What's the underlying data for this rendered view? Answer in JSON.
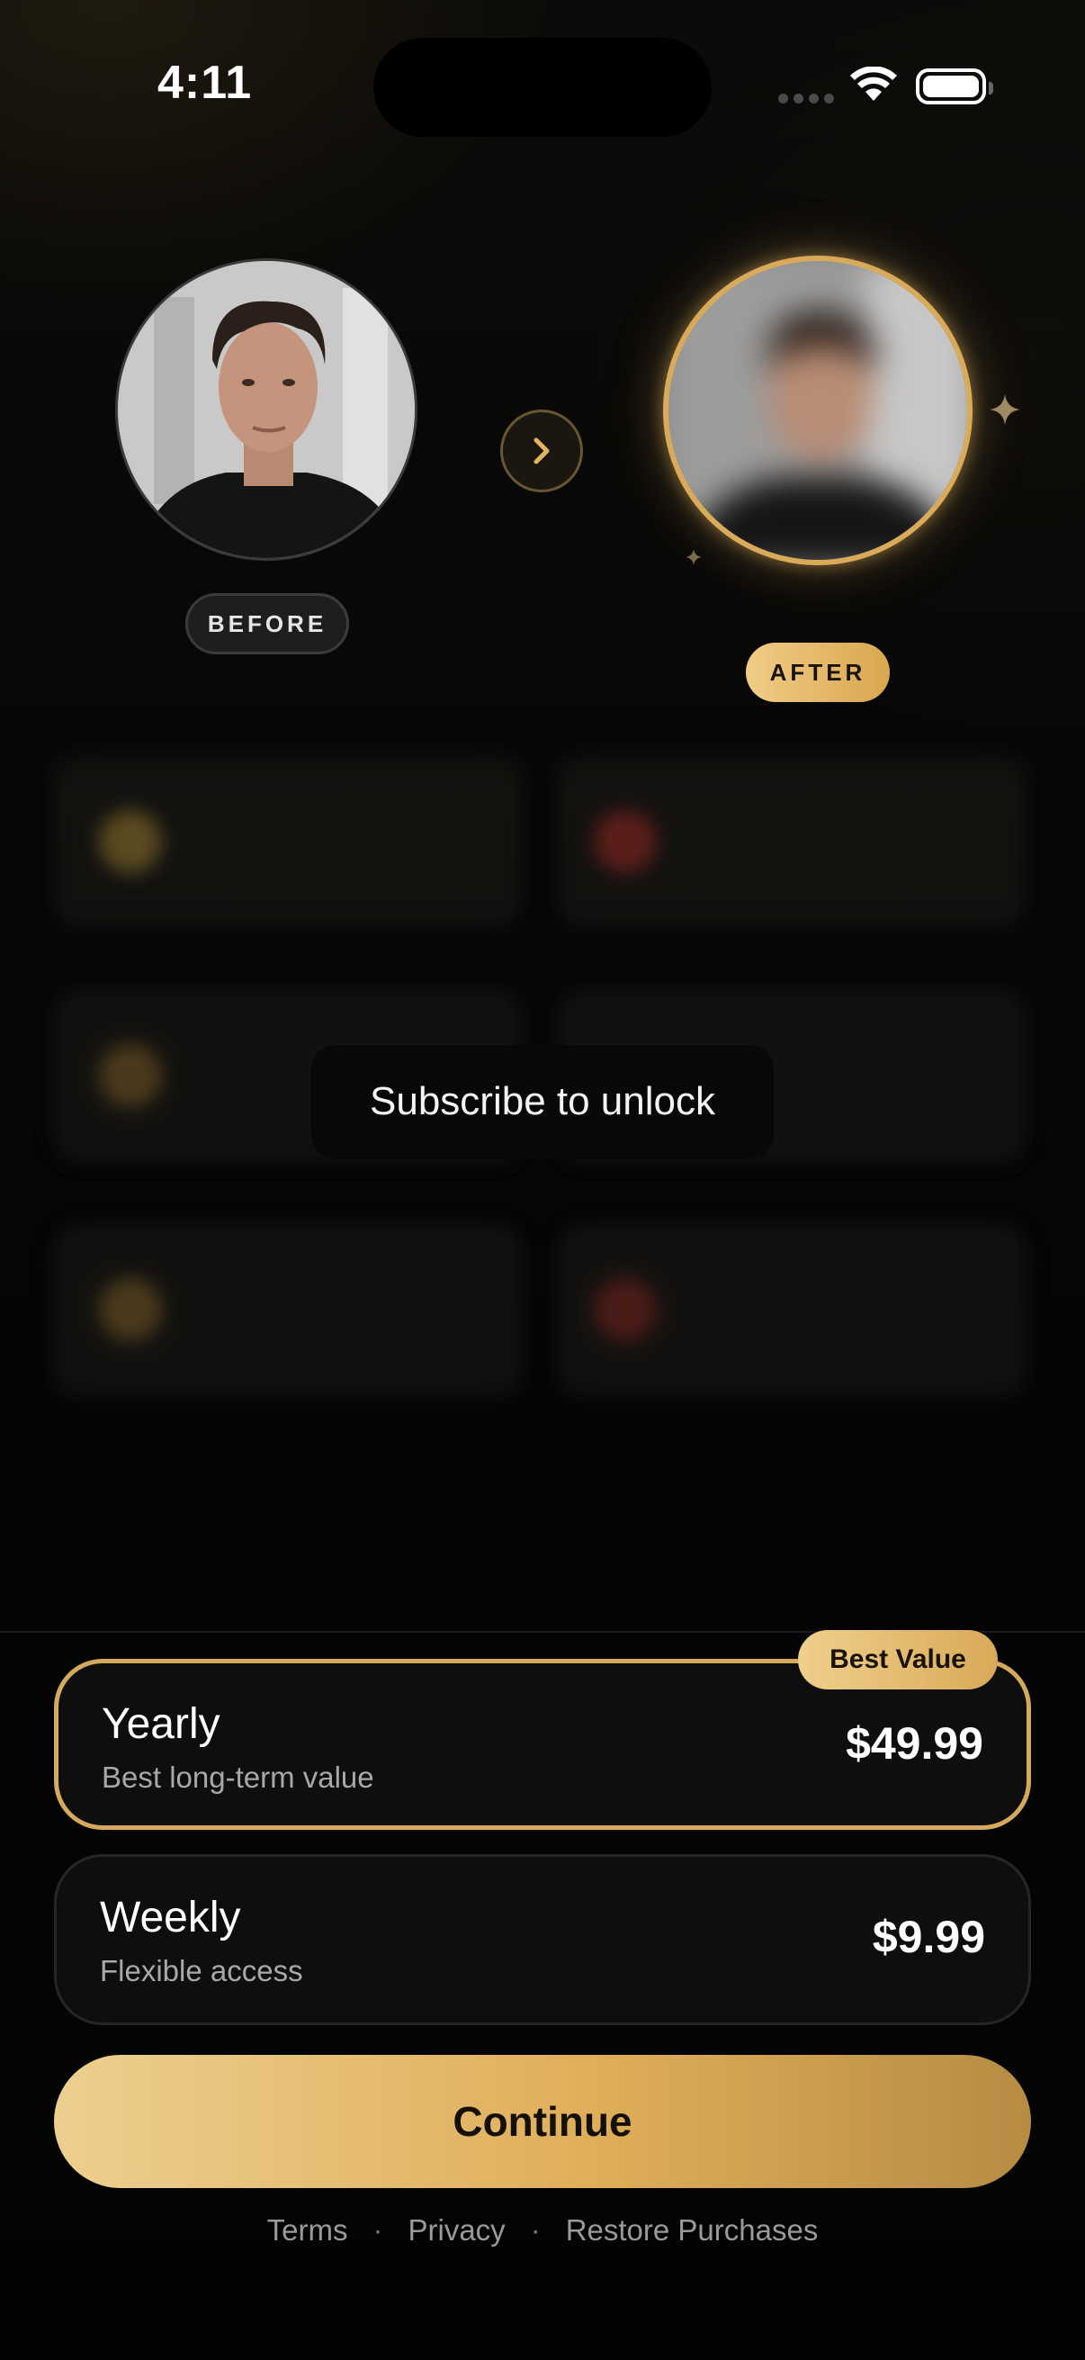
{
  "status_bar": {
    "time": "4:11"
  },
  "before_after": {
    "before_label": "BEFORE",
    "after_label": "AFTER"
  },
  "locked": {
    "overlay_text": "Subscribe to unlock"
  },
  "plans": [
    {
      "name": "Yearly",
      "subtitle": "Best long-term value",
      "price": "$49.99",
      "badge": "Best Value",
      "selected": true
    },
    {
      "name": "Weekly",
      "subtitle": "Flexible access",
      "price": "$9.99",
      "selected": false
    }
  ],
  "continue_label": "Continue",
  "footer": {
    "terms": "Terms",
    "privacy": "Privacy",
    "restore": "Restore Purchases",
    "separator": "·"
  },
  "colors": {
    "accent_gold": "#d8aa5a",
    "background": "#050505"
  },
  "icons": [
    "signal-icon",
    "wifi-icon",
    "battery-icon",
    "chevron-right-icon",
    "sparkle-icon"
  ]
}
